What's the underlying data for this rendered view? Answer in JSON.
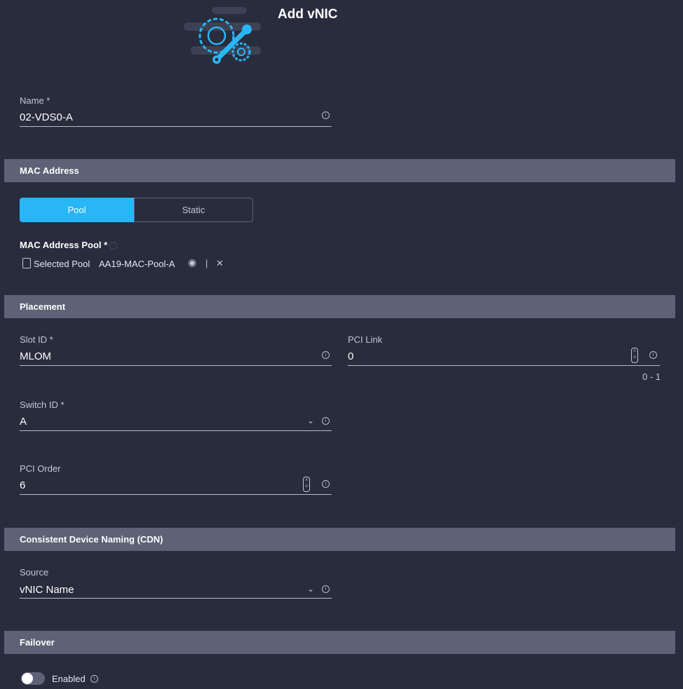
{
  "header": {
    "title": "Add vNIC",
    "icon": "gear-wrench-icon"
  },
  "name": {
    "label": "Name *",
    "value": "02-VDS0-A"
  },
  "mac": {
    "section": "MAC Address",
    "tabs": [
      "Pool",
      "Static"
    ],
    "active_tab": "Pool",
    "pool_label": "MAC Address Pool *",
    "selected_label": "Selected Pool",
    "selected_value": "AA19-MAC-Pool-A",
    "separator": "|"
  },
  "placement": {
    "section": "Placement",
    "slot": {
      "label": "Slot ID *",
      "value": "MLOM"
    },
    "pci_link": {
      "label": "PCI Link",
      "value": "0",
      "range": "0 - 1"
    },
    "switch": {
      "label": "Switch ID *",
      "value": "A"
    },
    "pci_order": {
      "label": "PCI Order",
      "value": "6"
    }
  },
  "cdn": {
    "section": "Consistent Device Naming (CDN)",
    "source": {
      "label": "Source",
      "value": "vNIC Name"
    }
  },
  "failover": {
    "section": "Failover",
    "toggle_label": "Enabled",
    "enabled": false
  },
  "colors": {
    "accent": "#29b6f6",
    "background": "#282c3d",
    "section": "#5d6276"
  }
}
